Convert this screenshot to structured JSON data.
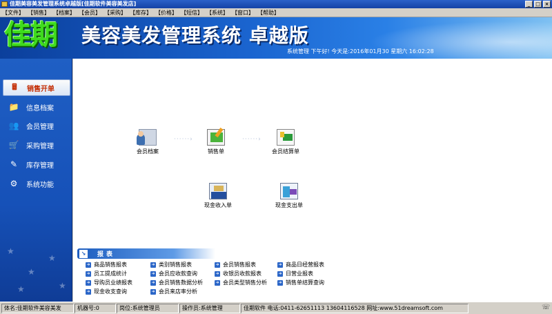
{
  "window": {
    "title": "佳期美容美发管理系统卓越版[佳期软件美容美发店]"
  },
  "menu": [
    {
      "label": "【文件】"
    },
    {
      "label": "【销售】"
    },
    {
      "label": "【档案】"
    },
    {
      "label": "【会员】"
    },
    {
      "label": "【采购】"
    },
    {
      "label": "【库存】"
    },
    {
      "label": "【价格】"
    },
    {
      "label": "【短信】"
    },
    {
      "label": "【系统】"
    },
    {
      "label": "【窗口】"
    },
    {
      "label": "【帮助】"
    }
  ],
  "banner": {
    "logo": "佳期",
    "system_title": "美容美发管理系统 卓越版",
    "status_line": "系统管理 下午好! 今天是:2016年01月30 星期六  16:02:28"
  },
  "sidebar": {
    "items": [
      {
        "label": "销售开单",
        "icon": "cash-register-icon",
        "active": true
      },
      {
        "label": "信息档案",
        "icon": "folder-icon",
        "active": false
      },
      {
        "label": "会员管理",
        "icon": "people-icon",
        "active": false
      },
      {
        "label": "采购管理",
        "icon": "shopping-icon",
        "active": false
      },
      {
        "label": "库存管理",
        "icon": "tools-icon",
        "active": false
      },
      {
        "label": "系统功能",
        "icon": "gear-icon",
        "active": false
      }
    ]
  },
  "flow": {
    "member_file": {
      "label": "会员档案",
      "icon": "member-file-icon"
    },
    "sales_order": {
      "label": "销售单",
      "icon": "sales-order-icon"
    },
    "member_settlement": {
      "label": "会员结算单",
      "icon": "member-settlement-icon"
    },
    "cash_in": {
      "label": "现金收入单",
      "icon": "cash-in-icon"
    },
    "cash_out": {
      "label": "现金支出单",
      "icon": "cash-out-icon"
    }
  },
  "reports": {
    "title": "报表",
    "columns": [
      [
        "商品销售报表",
        "员工提成统计",
        "导购员业绩报表",
        "现金收支查询"
      ],
      [
        "类别销售报表",
        "会员应收款查询",
        "会员销售数据分析",
        "会员来店率分析"
      ],
      [
        "会员销售报表",
        "收银员收款报表",
        "会员类型销售分析"
      ],
      [
        "商品日经营报表",
        "日营业报表",
        "销售单结算查询"
      ]
    ]
  },
  "statusbar": {
    "shop": "体名:佳期软件美容美发",
    "machine": "机器号:0",
    "post": "岗位:系统管理员",
    "operator": "操作员:系统管理",
    "company": "佳期软件 电话:0411-62651113 13604116528 网址:www.51dreamsoft.com"
  }
}
